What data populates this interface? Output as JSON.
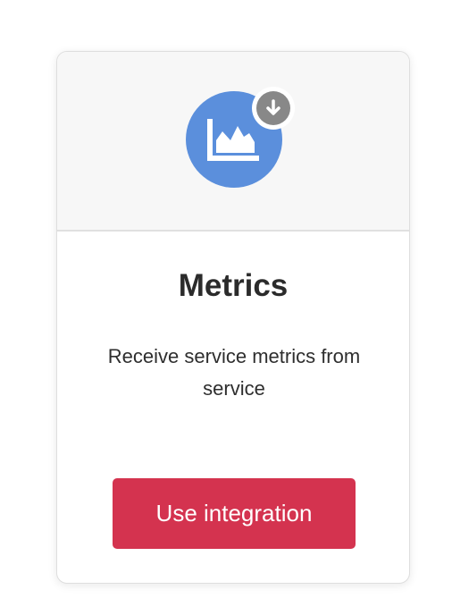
{
  "card": {
    "icon": "area-chart-icon",
    "badge_icon": "download-arrow-icon",
    "title": "Metrics",
    "description": "Receive service metrics from service",
    "button_label": "Use integration"
  },
  "colors": {
    "icon_background": "#5b8fdc",
    "badge_background": "#888888",
    "button_background": "#d4334f",
    "header_background": "#f7f7f7"
  }
}
